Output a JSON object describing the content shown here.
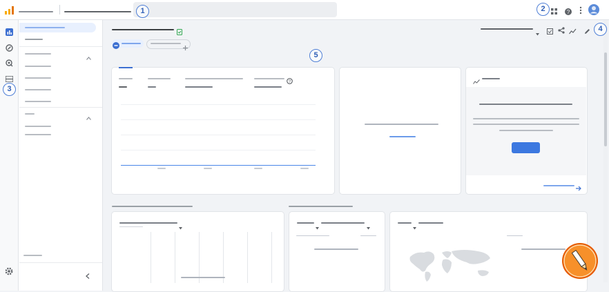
{
  "annotations": [
    "1",
    "2",
    "3",
    "4",
    "5"
  ],
  "icons": {
    "logo": "analytics-bar-logo",
    "apps": "apps-grid-icon",
    "help": "help-icon",
    "more": "more-vert-icon",
    "account": "account-avatar-icon",
    "reports": "reports-icon",
    "explore": "explore-icon",
    "advertising": "advertising-icon",
    "library": "library-icon",
    "settings": "gear-icon",
    "collapse": "chevron-left-icon",
    "customize": "customize-report-icon",
    "share": "share-icon",
    "insights": "insights-icon",
    "edit": "pencil-icon",
    "check": "check-doc-icon",
    "add": "plus-icon",
    "info": "info-icon",
    "arrow": "arrow-right-icon",
    "caret": "caret-down-icon"
  },
  "colors": {
    "accent": "#4a86e8",
    "logo_orange": "#f9ab00",
    "logo_dark": "#e37400",
    "check_green": "#34a853"
  }
}
